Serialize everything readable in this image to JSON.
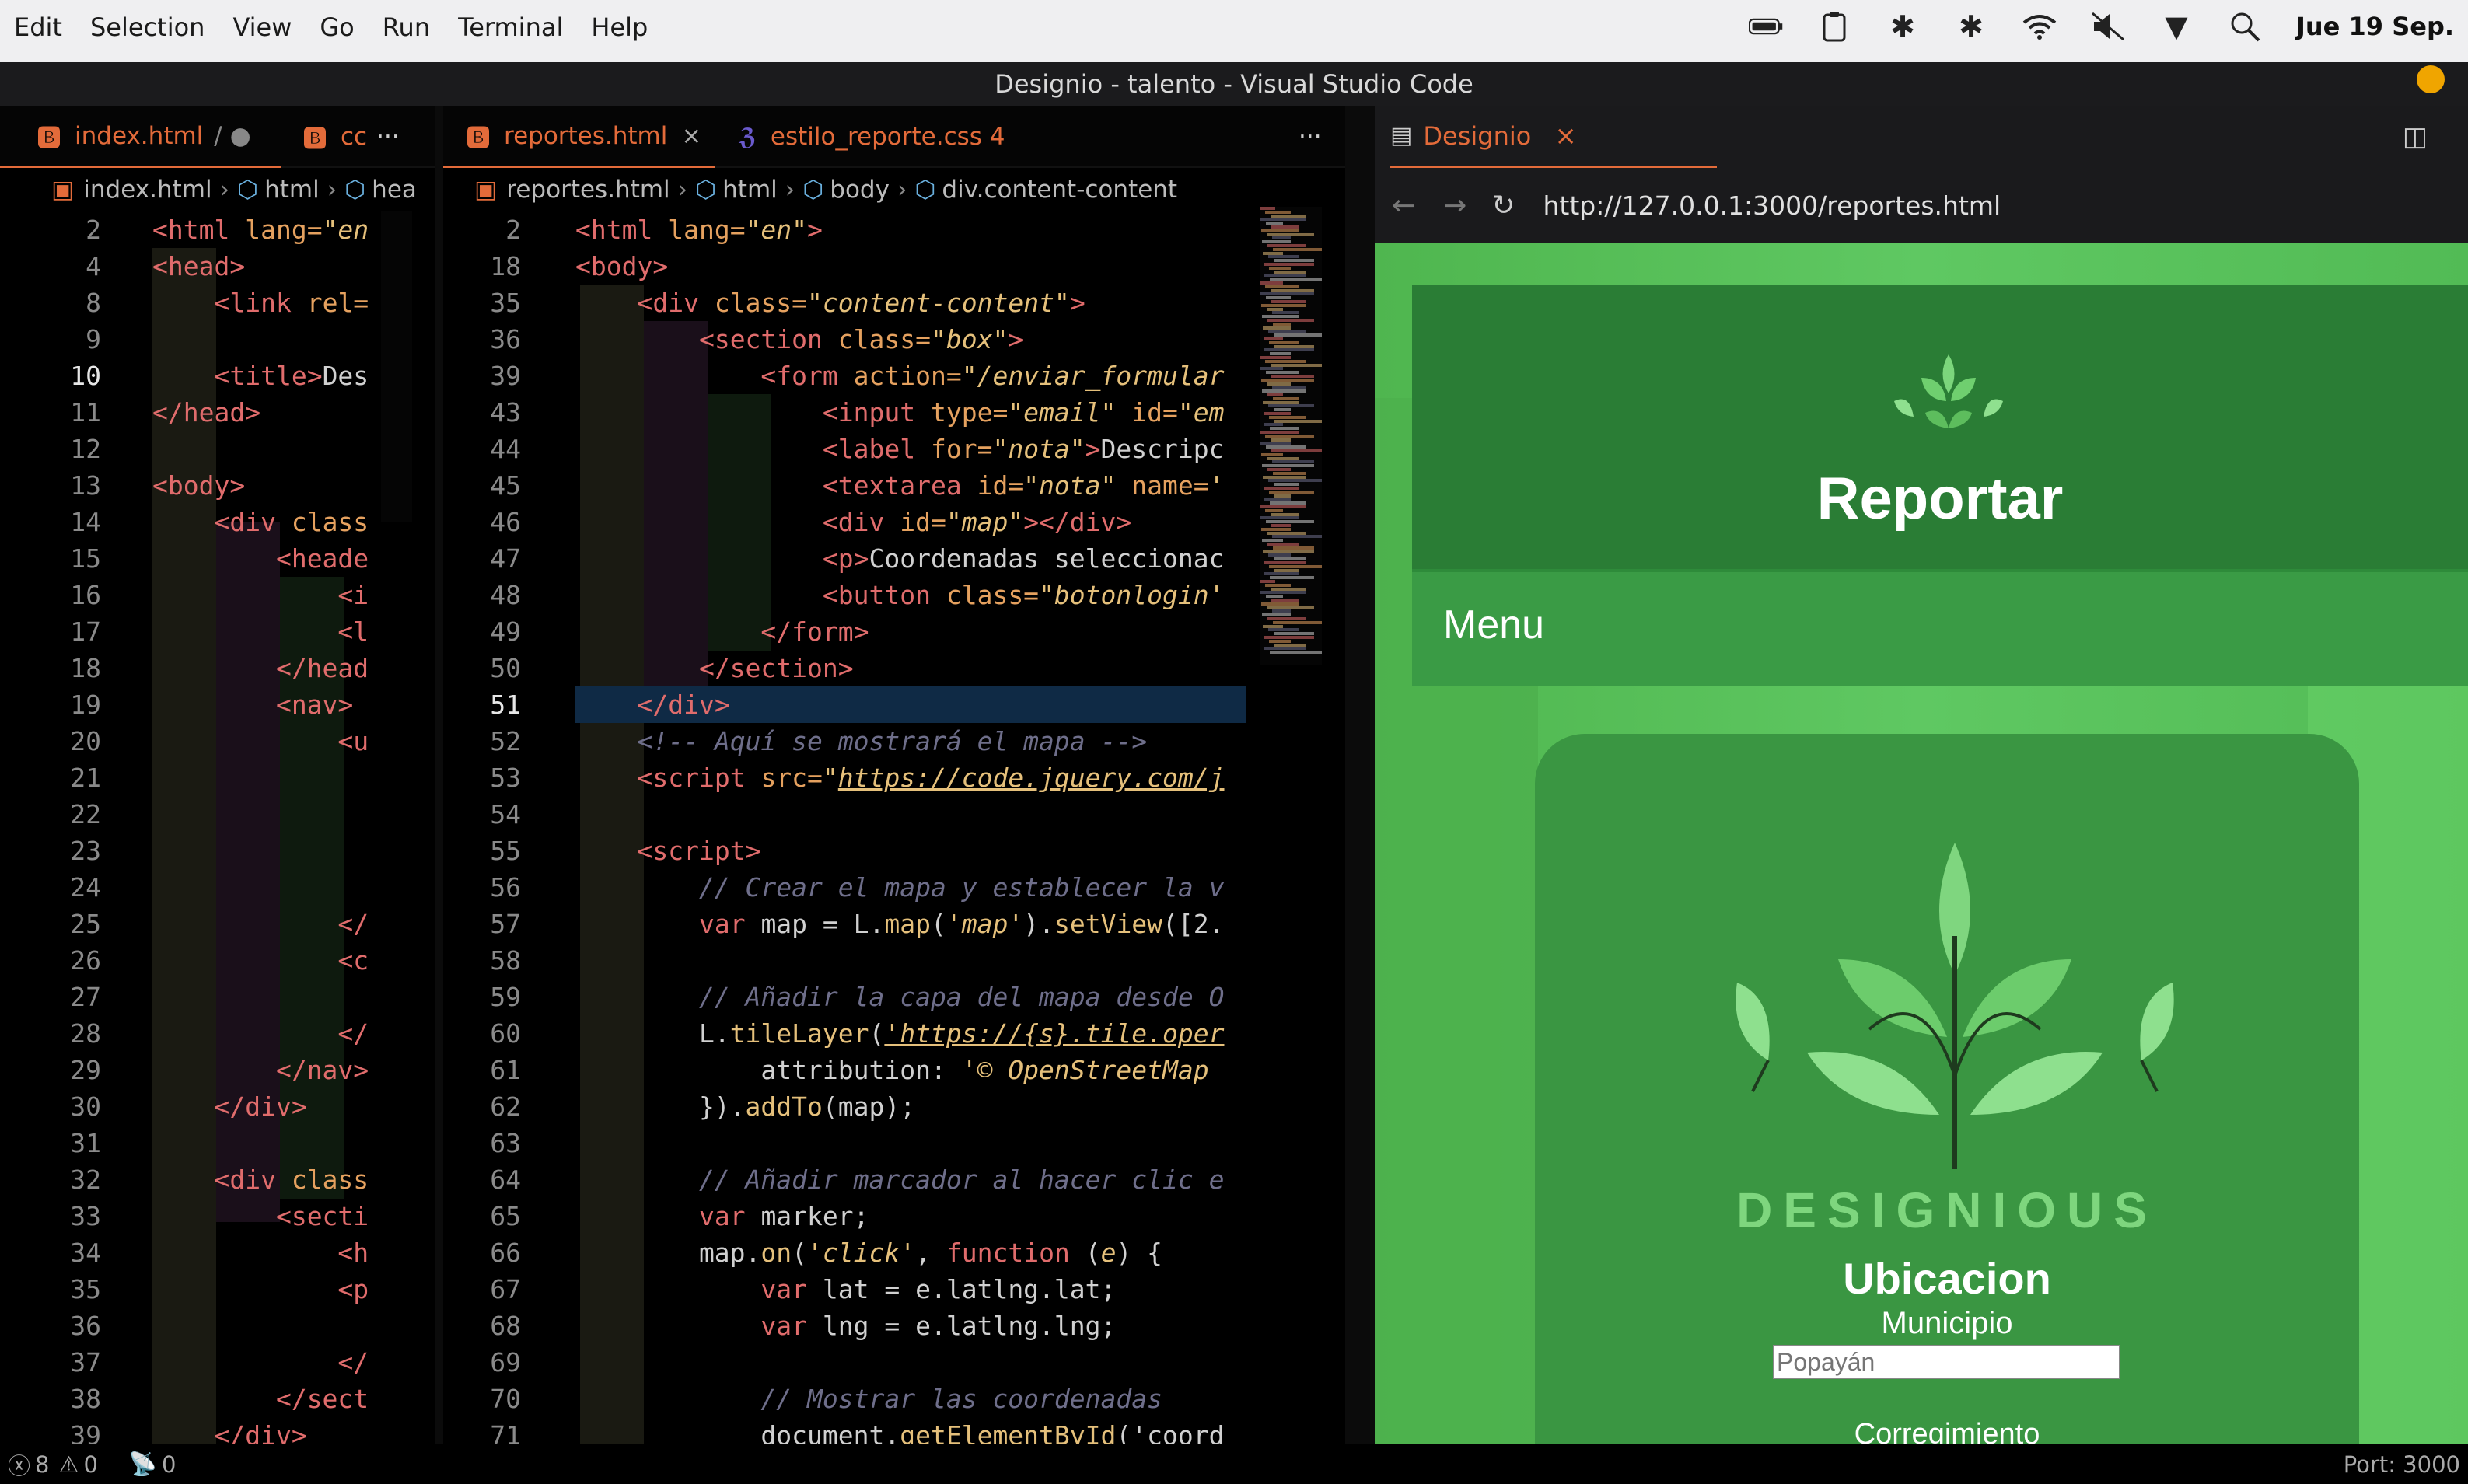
{
  "menubar": [
    "Edit",
    "Selection",
    "View",
    "Go",
    "Run",
    "Terminal",
    "Help"
  ],
  "clock": "Jue 19 Sep.",
  "window_title": "Designio - talento - Visual Studio Code",
  "left_group": {
    "tabs": [
      {
        "label": "index.html",
        "suffix": "/ ●"
      },
      {
        "label": "cc",
        "suffix": ""
      }
    ],
    "more": "···",
    "crumbs": [
      "index.html",
      "html",
      "hea"
    ],
    "lines": [
      {
        "n": "2",
        "t": [
          [
            "tag",
            "<html "
          ],
          [
            "attr",
            "lang="
          ],
          [
            "str",
            "\"en"
          ]
        ]
      },
      {
        "n": "4",
        "t": [
          [
            "tag",
            "<head>"
          ]
        ]
      },
      {
        "n": "8",
        "t": [
          [
            "plain",
            "    "
          ],
          [
            "tag",
            "<link "
          ],
          [
            "attr",
            "rel="
          ]
        ]
      },
      {
        "n": "9",
        "t": []
      },
      {
        "n": "10",
        "t": [
          [
            "plain",
            "    "
          ],
          [
            "tag",
            "<title>"
          ],
          [
            "plain",
            "Des"
          ]
        ]
      },
      {
        "n": "11",
        "t": [
          [
            "tag",
            "</head>"
          ]
        ]
      },
      {
        "n": "12",
        "t": []
      },
      {
        "n": "13",
        "t": [
          [
            "tag",
            "<body>"
          ]
        ]
      },
      {
        "n": "14",
        "t": [
          [
            "plain",
            "    "
          ],
          [
            "tag",
            "<div "
          ],
          [
            "attr",
            "class"
          ]
        ]
      },
      {
        "n": "15",
        "t": [
          [
            "plain",
            "        "
          ],
          [
            "tag",
            "<heade"
          ]
        ]
      },
      {
        "n": "16",
        "t": [
          [
            "plain",
            "            "
          ],
          [
            "tag",
            "<i"
          ]
        ]
      },
      {
        "n": "17",
        "t": [
          [
            "plain",
            "            "
          ],
          [
            "tag",
            "<l"
          ]
        ]
      },
      {
        "n": "18",
        "t": [
          [
            "plain",
            "        "
          ],
          [
            "tag",
            "</head"
          ]
        ]
      },
      {
        "n": "19",
        "t": [
          [
            "plain",
            "        "
          ],
          [
            "tag",
            "<nav>"
          ]
        ]
      },
      {
        "n": "20",
        "t": [
          [
            "plain",
            "            "
          ],
          [
            "tag",
            "<u"
          ]
        ]
      },
      {
        "n": "21",
        "t": []
      },
      {
        "n": "22",
        "t": []
      },
      {
        "n": "23",
        "t": []
      },
      {
        "n": "24",
        "t": []
      },
      {
        "n": "25",
        "t": [
          [
            "plain",
            "            "
          ],
          [
            "tag",
            "</"
          ]
        ]
      },
      {
        "n": "26",
        "t": [
          [
            "plain",
            "            "
          ],
          [
            "tag",
            "<c"
          ]
        ]
      },
      {
        "n": "27",
        "t": []
      },
      {
        "n": "28",
        "t": [
          [
            "plain",
            "            "
          ],
          [
            "tag",
            "</"
          ]
        ]
      },
      {
        "n": "29",
        "t": [
          [
            "plain",
            "        "
          ],
          [
            "tag",
            "</nav>"
          ]
        ]
      },
      {
        "n": "30",
        "t": [
          [
            "plain",
            "    "
          ],
          [
            "tag",
            "</div>"
          ]
        ]
      },
      {
        "n": "31",
        "t": []
      },
      {
        "n": "32",
        "t": [
          [
            "plain",
            "    "
          ],
          [
            "tag",
            "<div "
          ],
          [
            "attr",
            "class"
          ]
        ]
      },
      {
        "n": "33",
        "t": [
          [
            "plain",
            "        "
          ],
          [
            "tag",
            "<secti"
          ]
        ]
      },
      {
        "n": "34",
        "t": [
          [
            "plain",
            "            "
          ],
          [
            "tag",
            "<h"
          ]
        ]
      },
      {
        "n": "35",
        "t": [
          [
            "plain",
            "            "
          ],
          [
            "tag",
            "<p"
          ]
        ]
      },
      {
        "n": "36",
        "t": []
      },
      {
        "n": "37",
        "t": [
          [
            "plain",
            "            "
          ],
          [
            "tag",
            "</"
          ]
        ]
      },
      {
        "n": "38",
        "t": [
          [
            "plain",
            "        "
          ],
          [
            "tag",
            "</sect"
          ]
        ]
      },
      {
        "n": "39",
        "t": [
          [
            "plain",
            "    "
          ],
          [
            "tag",
            "</div>"
          ]
        ]
      }
    ]
  },
  "mid_group": {
    "tabs": [
      {
        "label": "reportes.html",
        "suffix": "×"
      },
      {
        "label": "estilo_reporte.css 4",
        "suffix": ""
      }
    ],
    "more": "···",
    "crumbs": [
      "reportes.html",
      "html",
      "body",
      "div.content-content"
    ],
    "lines": [
      {
        "n": "2",
        "t": [
          [
            "tag",
            "<html "
          ],
          [
            "attr",
            "lang="
          ],
          [
            "str",
            "\"en\""
          ],
          [
            "tag",
            ">"
          ]
        ]
      },
      {
        "n": "18",
        "t": [
          [
            "tag",
            "<body>"
          ]
        ]
      },
      {
        "n": "35",
        "t": [
          [
            "plain",
            "    "
          ],
          [
            "tag",
            "<div "
          ],
          [
            "attr",
            "class="
          ],
          [
            "str",
            "\"content-content\""
          ],
          [
            "tag",
            ">"
          ]
        ]
      },
      {
        "n": "36",
        "t": [
          [
            "plain",
            "        "
          ],
          [
            "tag",
            "<section "
          ],
          [
            "attr",
            "class="
          ],
          [
            "str",
            "\"box\""
          ],
          [
            "tag",
            ">"
          ]
        ]
      },
      {
        "n": "39",
        "t": [
          [
            "plain",
            "            "
          ],
          [
            "tag",
            "<form "
          ],
          [
            "attr",
            "action="
          ],
          [
            "str",
            "\"/enviar_formular"
          ]
        ]
      },
      {
        "n": "43",
        "t": [
          [
            "plain",
            "                "
          ],
          [
            "tag",
            "<input "
          ],
          [
            "attr",
            "type="
          ],
          [
            "str",
            "\"email\""
          ],
          [
            "attr",
            " id="
          ],
          [
            "str",
            "\"em"
          ]
        ]
      },
      {
        "n": "44",
        "t": [
          [
            "plain",
            "                "
          ],
          [
            "tag",
            "<label "
          ],
          [
            "attr",
            "for="
          ],
          [
            "str",
            "\"nota\""
          ],
          [
            "tag",
            ">"
          ],
          [
            "plain",
            "Descripc"
          ]
        ]
      },
      {
        "n": "45",
        "t": [
          [
            "plain",
            "                "
          ],
          [
            "tag",
            "<textarea "
          ],
          [
            "attr",
            "id="
          ],
          [
            "str",
            "\"nota\""
          ],
          [
            "attr",
            " name="
          ],
          [
            "str",
            "'"
          ]
        ]
      },
      {
        "n": "46",
        "t": [
          [
            "plain",
            "                "
          ],
          [
            "tag",
            "<div "
          ],
          [
            "attr",
            "id="
          ],
          [
            "str",
            "\"map\""
          ],
          [
            "tag",
            "></div>"
          ]
        ]
      },
      {
        "n": "47",
        "t": [
          [
            "plain",
            "                "
          ],
          [
            "tag",
            "<p>"
          ],
          [
            "plain",
            "Coordenadas seleccionac"
          ]
        ]
      },
      {
        "n": "48",
        "t": [
          [
            "plain",
            "                "
          ],
          [
            "tag",
            "<button "
          ],
          [
            "attr",
            "class="
          ],
          [
            "str",
            "\"botonlogin'"
          ]
        ]
      },
      {
        "n": "49",
        "t": [
          [
            "plain",
            "            "
          ],
          [
            "tag",
            "</form>"
          ]
        ]
      },
      {
        "n": "50",
        "t": [
          [
            "plain",
            "        "
          ],
          [
            "tag",
            "</section>"
          ]
        ]
      },
      {
        "n": "51",
        "t": [
          [
            "plain",
            "    "
          ],
          [
            "tag",
            "</div>"
          ]
        ]
      },
      {
        "n": "52",
        "t": [
          [
            "plain",
            "    "
          ],
          [
            "cmt",
            "<!-- Aquí se mostrará el mapa -->"
          ]
        ]
      },
      {
        "n": "53",
        "t": [
          [
            "plain",
            "    "
          ],
          [
            "tag",
            "<script "
          ],
          [
            "attr",
            "src="
          ],
          [
            "str",
            "\""
          ],
          [
            "url",
            "https://code.jquery.com/j"
          ]
        ]
      },
      {
        "n": "54",
        "t": []
      },
      {
        "n": "55",
        "t": [
          [
            "plain",
            "    "
          ],
          [
            "tag",
            "<script>"
          ]
        ]
      },
      {
        "n": "56",
        "t": [
          [
            "plain",
            "        "
          ],
          [
            "cmt",
            "// Crear el mapa y establecer la v"
          ]
        ]
      },
      {
        "n": "57",
        "t": [
          [
            "plain",
            "        "
          ],
          [
            "kw",
            "var "
          ],
          [
            "plain",
            "map = L."
          ],
          [
            "fn",
            "map"
          ],
          [
            "plain",
            "("
          ],
          [
            "str",
            "'map'"
          ],
          [
            "plain",
            ")."
          ],
          [
            "fn",
            "setView"
          ],
          [
            "plain",
            "([2."
          ]
        ]
      },
      {
        "n": "58",
        "t": []
      },
      {
        "n": "59",
        "t": [
          [
            "plain",
            "        "
          ],
          [
            "cmt",
            "// Añadir la capa del mapa desde O"
          ]
        ]
      },
      {
        "n": "60",
        "t": [
          [
            "plain",
            "        L."
          ],
          [
            "fn",
            "tileLayer"
          ],
          [
            "plain",
            "("
          ],
          [
            "url",
            "'https://{s}.tile.oper"
          ]
        ]
      },
      {
        "n": "61",
        "t": [
          [
            "plain",
            "            attribution: "
          ],
          [
            "str",
            "'© OpenStreetMap"
          ]
        ]
      },
      {
        "n": "62",
        "t": [
          [
            "plain",
            "        })."
          ],
          [
            "fn",
            "addTo"
          ],
          [
            "plain",
            "(map);"
          ]
        ]
      },
      {
        "n": "63",
        "t": []
      },
      {
        "n": "64",
        "t": [
          [
            "plain",
            "        "
          ],
          [
            "cmt",
            "// Añadir marcador al hacer clic e"
          ]
        ]
      },
      {
        "n": "65",
        "t": [
          [
            "plain",
            "        "
          ],
          [
            "kw",
            "var "
          ],
          [
            "plain",
            "marker;"
          ]
        ]
      },
      {
        "n": "66",
        "t": [
          [
            "plain",
            "        map."
          ],
          [
            "fn",
            "on"
          ],
          [
            "plain",
            "("
          ],
          [
            "str",
            "'click'"
          ],
          [
            "plain",
            ", "
          ],
          [
            "kw",
            "function "
          ],
          [
            "plain",
            "("
          ],
          [
            "str",
            "e"
          ],
          [
            "plain",
            ") {"
          ]
        ]
      },
      {
        "n": "67",
        "t": [
          [
            "plain",
            "            "
          ],
          [
            "kw",
            "var "
          ],
          [
            "plain",
            "lat = e.latlng.lat;"
          ]
        ]
      },
      {
        "n": "68",
        "t": [
          [
            "plain",
            "            "
          ],
          [
            "kw",
            "var "
          ],
          [
            "plain",
            "lng = e.latlng.lng;"
          ]
        ]
      },
      {
        "n": "69",
        "t": []
      },
      {
        "n": "70",
        "t": [
          [
            "plain",
            "            "
          ],
          [
            "cmt",
            "// Mostrar las coordenadas"
          ]
        ]
      },
      {
        "n": "71",
        "t": [
          [
            "plain",
            "            document."
          ],
          [
            "fn",
            "getElementById"
          ],
          [
            "plain",
            "('coord"
          ]
        ]
      }
    ]
  },
  "preview": {
    "tab_label": "Designio",
    "url": "http://127.0.0.1:3000/reportes.html",
    "header_title": "Reportar",
    "menu_label": "Menu",
    "brand": "DESIGNIOUS",
    "section_title": "Ubicacion",
    "field_label": "Municipio",
    "field_placeholder": "Popayán",
    "next_label": "Corregimiento"
  },
  "status": {
    "errors": "8",
    "warnings": "0",
    "ports": "0",
    "port_label": "Port: 3000"
  },
  "colors": {
    "accent": "#e36b3a",
    "page_green": "#56c159",
    "header_green": "#2f8a3c",
    "card_green": "#3d9e44",
    "selection": "#0f2a45"
  }
}
